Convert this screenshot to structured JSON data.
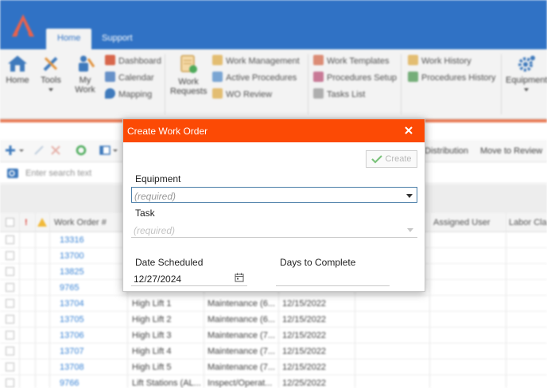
{
  "ribbon": {
    "tabs": [
      "Home",
      "Support"
    ],
    "home_label": "Home",
    "tools_label": "Tools",
    "my_work_label": "My Work",
    "dashboard_label": "Dashboard",
    "calendar_label": "Calendar",
    "mapping_label": "Mapping",
    "work_requests_label": "Work Requests",
    "work_management_label": "Work Management",
    "active_procedures_label": "Active Procedures",
    "wo_review_label": "WO Review",
    "work_templates_label": "Work Templates",
    "procedures_setup_label": "Procedures Setup",
    "tasks_list_label": "Tasks List",
    "work_history_label": "Work History",
    "procedures_history_label": "Procedures History",
    "equipment_label": "Equipment"
  },
  "toolbar": {
    "distribution_label": "Distribution",
    "move_to_review_label": "Move to Review"
  },
  "search": {
    "placeholder": "Enter search text"
  },
  "grid": {
    "headers": {
      "work_order": "Work Order #",
      "assigned_user": "Assigned User",
      "labor_class": "Labor Cla"
    },
    "rows": [
      {
        "wo": "13316",
        "equipment": "",
        "task": "",
        "date": ""
      },
      {
        "wo": "13700",
        "equipment": "",
        "task": "",
        "date": ""
      },
      {
        "wo": "13825",
        "equipment": "",
        "task": "",
        "date": ""
      },
      {
        "wo": "9765",
        "equipment": "",
        "task": "",
        "date": ""
      },
      {
        "wo": "13704",
        "equipment": "High Lift 1",
        "task": "Maintenance (6...",
        "date": "12/15/2022"
      },
      {
        "wo": "13705",
        "equipment": "High Lift 2",
        "task": "Maintenance (6...",
        "date": "12/15/2022"
      },
      {
        "wo": "13706",
        "equipment": "High Lift 3",
        "task": "Maintenance (7...",
        "date": "12/15/2022"
      },
      {
        "wo": "13707",
        "equipment": "High Lift 4",
        "task": "Maintenance (7...",
        "date": "12/15/2022"
      },
      {
        "wo": "13708",
        "equipment": "High Lift 5",
        "task": "Maintenance (7...",
        "date": "12/15/2022"
      },
      {
        "wo": "9766",
        "equipment": "Lift Stations (AL...",
        "task": "Inspect/Operat...",
        "date": "12/25/2022"
      }
    ]
  },
  "dialog": {
    "title": "Create Work Order",
    "create_label": "Create",
    "equipment_label": "Equipment",
    "equipment_placeholder": "(required)",
    "task_label": "Task",
    "task_placeholder": "(required)",
    "date_scheduled_label": "Date Scheduled",
    "date_scheduled_value": "12/27/2024",
    "days_to_complete_label": "Days to Complete",
    "days_to_complete_value": ""
  },
  "colors": {
    "brand_blue": "#1f67c0",
    "dialog_header": "#fc4a05",
    "link": "#2a7ad2",
    "accent_orange": "#e8724a"
  }
}
